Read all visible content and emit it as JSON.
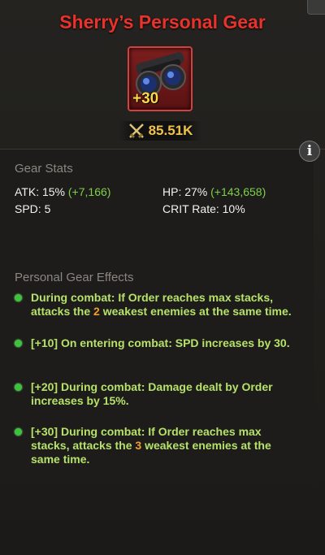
{
  "title": "Sherry’s Personal Gear",
  "gear": {
    "icon": "binoculars-icon",
    "level": "+30",
    "power": "85.51K",
    "power_icon": "crossed-swords-icon"
  },
  "colors": {
    "title": "#e8322b",
    "bonus": "#7ed04a",
    "effect_text": "#b6e26a",
    "highlight": "#f0a02a",
    "power": "#f0c24a"
  },
  "stats": {
    "section_title": "Gear Stats",
    "atk": {
      "label": "ATK: 15%",
      "bonus": "(+7,166)"
    },
    "hp": {
      "label": "HP: 27%",
      "bonus": "(+143,658)"
    },
    "spd": {
      "label": "SPD: 5"
    },
    "crit": {
      "label": "CRIT Rate: 10%"
    }
  },
  "effects": {
    "section_title": "Personal Gear Effects",
    "items": [
      {
        "pre": "During combat: If Order reaches max stacks, attacks the ",
        "num": "2",
        "post": " weakest enemies at the same time."
      },
      {
        "text": "[+10] On entering combat: SPD increases by 30."
      },
      {
        "text": "[+20] During combat: Damage dealt by Order increases by 15%."
      },
      {
        "pre": "[+30] During combat: If Order reaches max stacks, attacks the ",
        "num": "3",
        "post": " weakest enemies at the same time."
      }
    ]
  }
}
